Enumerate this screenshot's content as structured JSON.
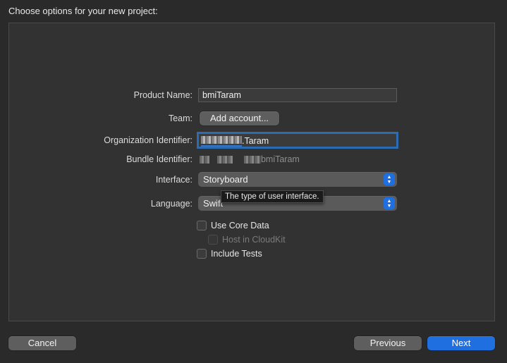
{
  "dialog": {
    "title": "Choose options for your new project:"
  },
  "form": {
    "product_name_label": "Product Name:",
    "product_name_value": "bmiTaram",
    "team_label": "Team:",
    "team_button": "Add account...",
    "org_id_label": "Organization Identifier:",
    "org_id_suffix": ".Taram",
    "bundle_id_label": "Bundle Identifier:",
    "bundle_id_suffix": "bmiTaram",
    "interface_label": "Interface:",
    "interface_value": "Storyboard",
    "language_label": "Language:",
    "language_value": "Swift",
    "use_core_data": "Use Core Data",
    "host_in_cloudkit": "Host in CloudKit",
    "include_tests": "Include Tests"
  },
  "tooltip": {
    "text": "The type of user interface."
  },
  "footer": {
    "cancel": "Cancel",
    "previous": "Previous",
    "next": "Next"
  },
  "colors": {
    "accent": "#1f6fe0",
    "focus_ring": "#2b6cb3",
    "background": "#2a2a2a",
    "panel": "#323232"
  }
}
